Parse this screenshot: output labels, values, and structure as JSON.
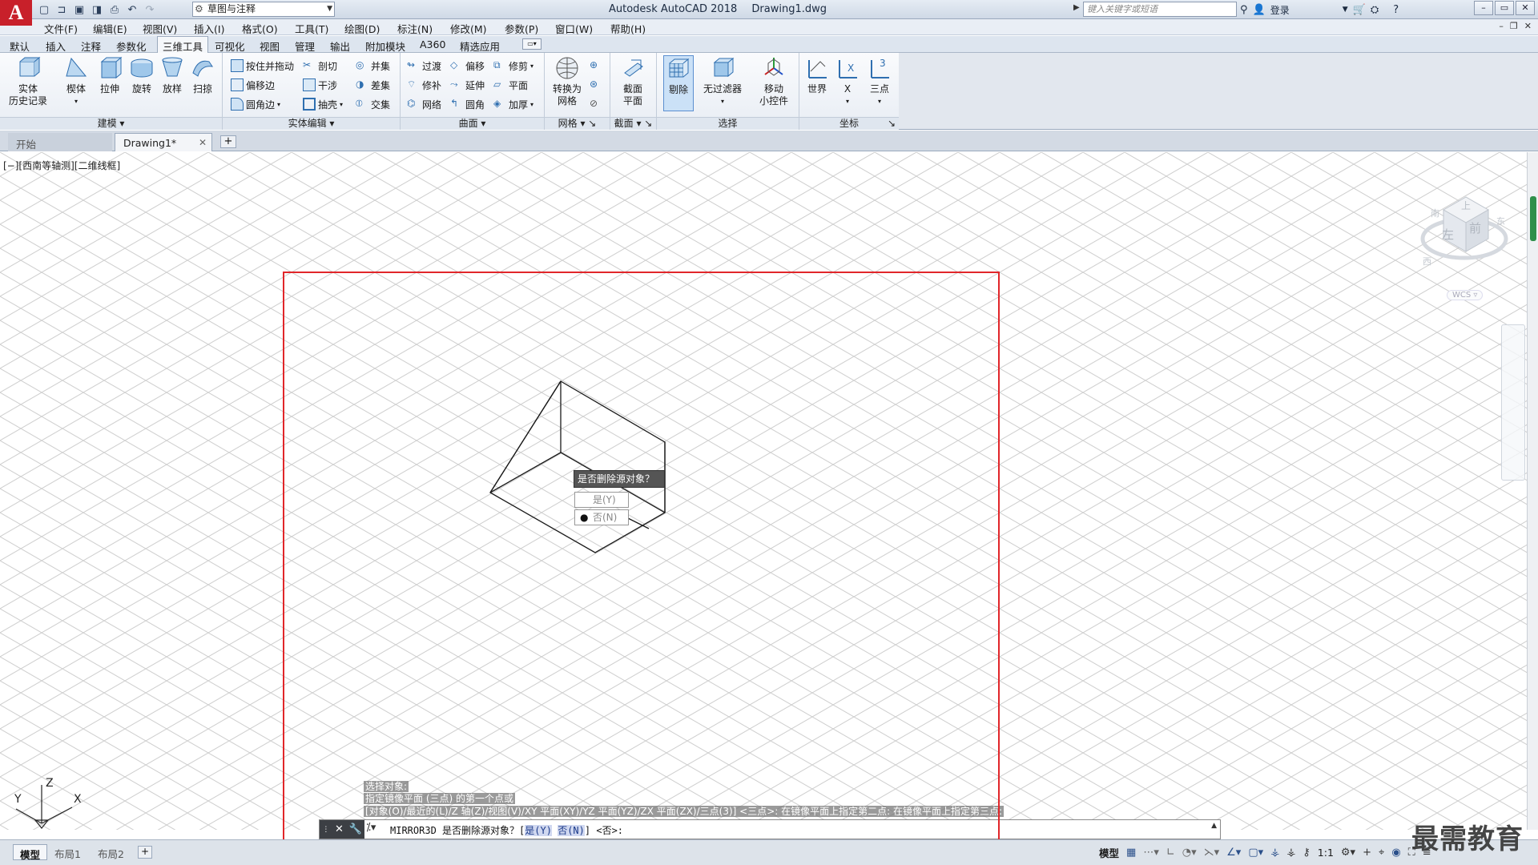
{
  "app": {
    "logo_letter": "A",
    "title_app": "Autodesk AutoCAD 2018",
    "title_file": "Drawing1.dwg",
    "workspace": "草图与注释",
    "search_placeholder": "键入关键字或短语",
    "login_label": "登录"
  },
  "quick_access": [
    "new-icon",
    "open-icon",
    "save-icon",
    "save-as-icon",
    "print-icon",
    "undo-icon",
    "redo-icon"
  ],
  "menu": [
    "文件(F)",
    "编辑(E)",
    "视图(V)",
    "插入(I)",
    "格式(O)",
    "工具(T)",
    "绘图(D)",
    "标注(N)",
    "修改(M)",
    "参数(P)",
    "窗口(W)",
    "帮助(H)"
  ],
  "ribbon_tabs": [
    "默认",
    "插入",
    "注释",
    "参数化",
    "三维工具",
    "可视化",
    "视图",
    "管理",
    "输出",
    "附加模块",
    "A360",
    "精选应用"
  ],
  "ribbon_active_tab": "三维工具",
  "ribbon": {
    "history_l1": "实体",
    "history_l2": "历史记录",
    "panel_model": "建模",
    "panel_solid_edit": "实体编辑",
    "panel_surface": "曲面",
    "panel_mesh": "网格",
    "panel_section": "截面",
    "panel_selection": "选择",
    "panel_coords": "坐标",
    "model_buttons": [
      "楔体",
      "拉伸",
      "旋转",
      "放样",
      "扫掠"
    ],
    "solid_edit": {
      "presspull": "按住并拖动",
      "offset_edge": "偏移边",
      "fillet_edge": "圆角边",
      "slice": "剖切",
      "interfere": "干涉",
      "shell": "抽壳",
      "union": "并集",
      "subtract": "差集",
      "intersect": "交集"
    },
    "surface": {
      "blend": "过渡",
      "patch": "修补",
      "network": "网络",
      "offset": "偏移",
      "extend": "延伸",
      "fillet": "圆角",
      "trim": "修剪",
      "planar": "平面",
      "thicken": "加厚"
    },
    "mesh_convert_l1": "转换为",
    "mesh_convert_l2": "网格",
    "section_plane_l1": "截面",
    "section_plane_l2": "平面",
    "culling": "剔除",
    "no_filter": "无过滤器",
    "gizmo_l1": "移动",
    "gizmo_l2": "小控件",
    "ucs_world": "世界",
    "ucs_x": "X",
    "ucs_3point": "三点"
  },
  "doc_tabs": {
    "start": "开始",
    "active": "Drawing1*"
  },
  "viewport": {
    "label": "[−][西南等轴测][二维线框]",
    "viewcube": {
      "top": "上",
      "left": "左",
      "front": "前",
      "south": "南",
      "west": "西",
      "east": "东",
      "wcs": "WCS"
    },
    "ucs_axes": {
      "x": "X",
      "y": "Y",
      "z": "Z"
    }
  },
  "popup": {
    "title": "是否删除源对象？",
    "option_yes": "是(Y)",
    "option_no": "否(N)",
    "selected_bullet": "●"
  },
  "command_history": [
    "选择对象:",
    "指定镜像平面 (三点) 的第一个点或",
    "[对象(O)/最近的(L)/Z 轴(Z)/视图(V)/XY 平面(XY)/YZ 平面(YZ)/ZX 平面(ZX)/三点(3)] <三点>: 在镜像平面上指定第二点: 在镜像平面上指定第三点:"
  ],
  "command_line": {
    "prefix": "MIRROR3D 是否删除源对象？[",
    "opt_yes_a": "是",
    "opt_yes_key": "(Y)",
    "space": " ",
    "opt_no_a": "否",
    "opt_no_key": "(N)",
    "suffix": "] <否>:"
  },
  "status": {
    "layout_tabs": [
      "模型",
      "布局1",
      "布局2"
    ],
    "model_label": "模型",
    "scale": "1:1"
  },
  "watermark": "最需教育",
  "colors": {
    "selection_box": "#e1262a",
    "accent": "#c8202a",
    "grid": "#c9c9c9"
  }
}
